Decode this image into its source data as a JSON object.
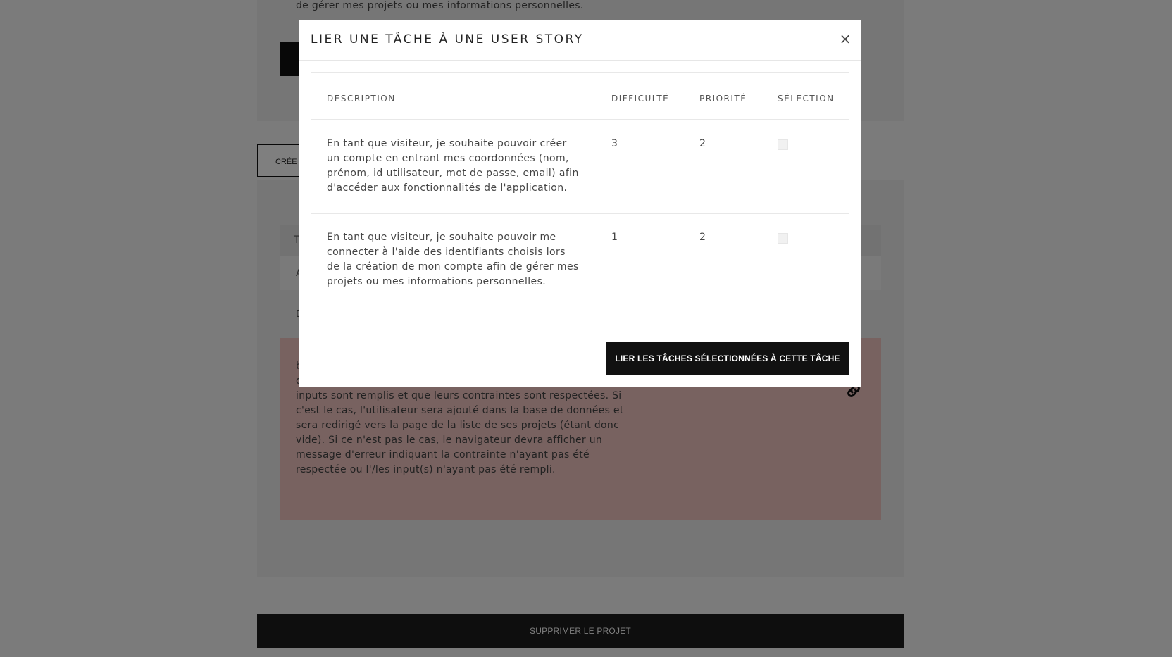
{
  "background": {
    "top_text": "de gérer mes projets ou mes informations personnelles.",
    "create_button_label": "CRÉE",
    "table_header_char": "T",
    "row_a_char": "A",
    "row_d_char": "D",
    "task_card_text": "bouton \"Créer un nouveau compte\" de la page d'inscription devra avoir le comportement suivant : il vérifiera que tous les inputs sont remplis et que leurs contraintes sont respectées. Si c'est le cas, l'utilisateur sera ajouté dans la base de données et sera redirigé vers la page de la liste de ses projets (étant donc vide). Si ce n'est pas le cas, le navigateur devra afficher un message d'erreur indiquant la contrainte n'ayant pas été respectée ou l'/les input(s) n'ayant pas été rempli.",
    "delete_project_label": "SUPPRIMER LE PROJET"
  },
  "modal": {
    "title": "LIER UNE TÂCHE À UNE USER STORY",
    "close_symbol": "×",
    "columns": [
      "DESCRIPTION",
      "DIFFICULTÉ",
      "PRIORITÉ",
      "SÉLECTION"
    ],
    "rows": [
      {
        "description": "En tant que visiteur, je souhaite pouvoir créer un compte en entrant mes coordonnées (nom, prénom, id utilisateur, mot de passe, email) afin d'accéder aux fonctionnalités de l'application.",
        "difficulty": "3",
        "priority": "2"
      },
      {
        "description": "En tant que visiteur, je souhaite pouvoir me connecter à l'aide des identifiants choisis lors de la création de mon compte afin de gérer mes projets ou mes informations personnelles.",
        "difficulty": "1",
        "priority": "2"
      }
    ],
    "submit_label": "LIER LES TÂCHES SÉLECTIONNÉES À CETTE TÂCHE"
  },
  "colors": {
    "overlay": "rgba(0,0,0,0.5)",
    "button_dark": "#111111",
    "task_card": "#f0c4c0"
  }
}
